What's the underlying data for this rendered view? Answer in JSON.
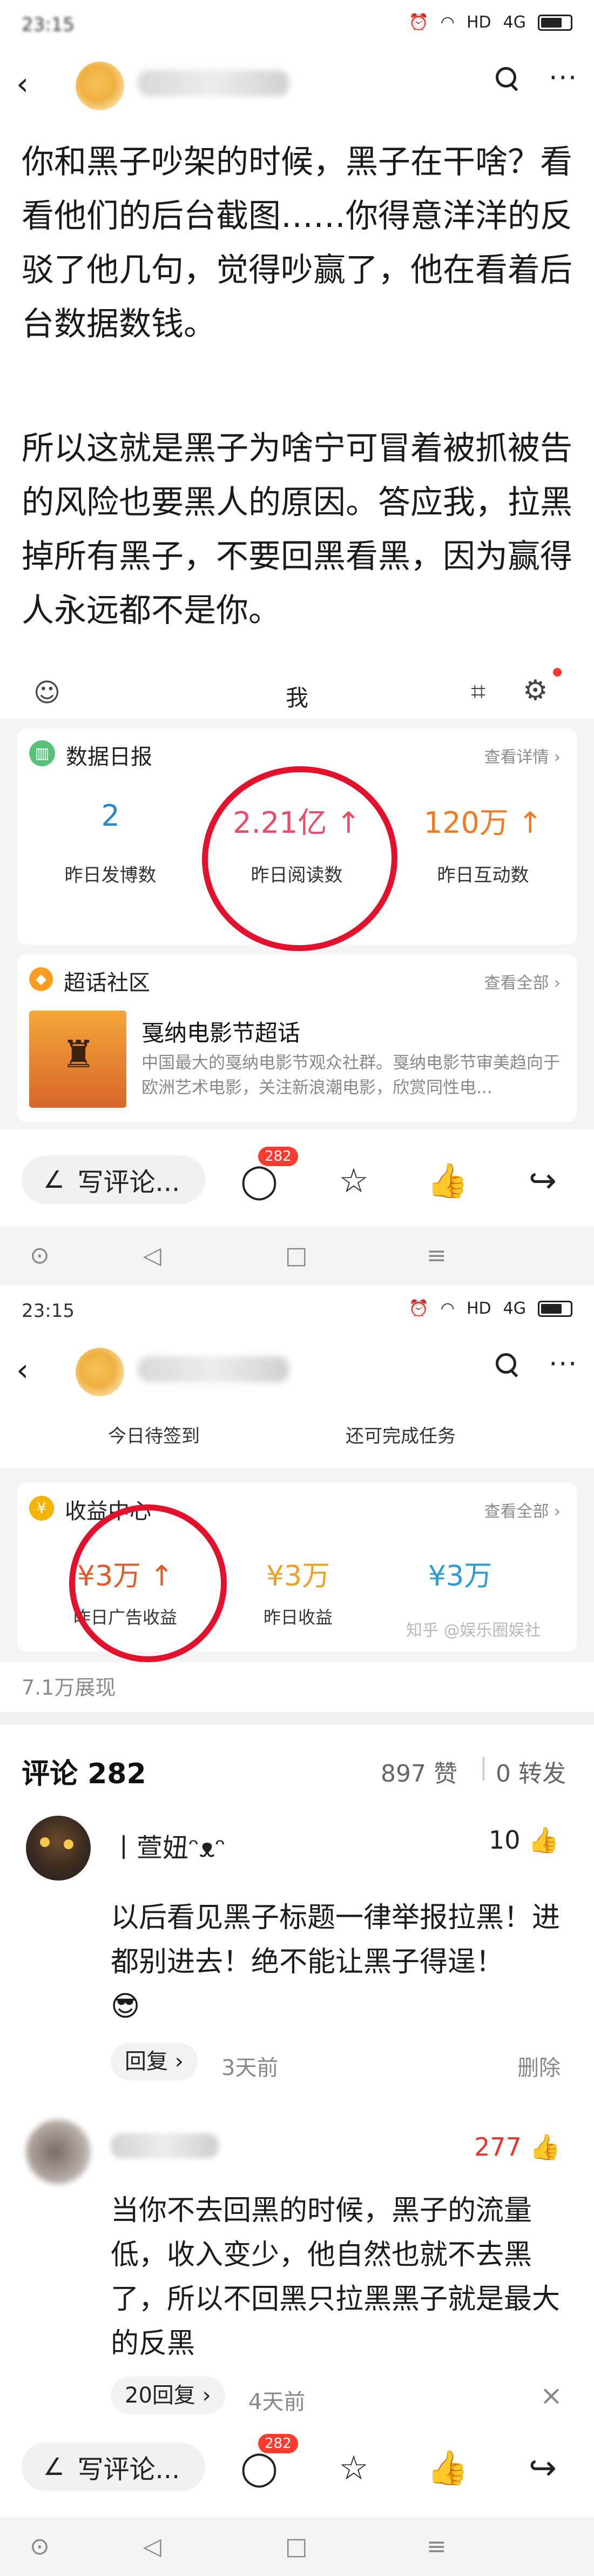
{
  "status": {
    "time_1": "23:15",
    "time_2": "23:15",
    "net": "HD",
    "signal": "4G"
  },
  "post": {
    "paragraph_1": "你和黑子吵架的时候，黑子在干啥？看看他们的后台截图……你得意洋洋的反驳了他几句，觉得吵赢了，他在看着后台数据数钱。",
    "paragraph_2": "所以这就是黑子为啥宁可冒着被抓被告的风险也要黑人的原因。答应我，拉黑掉所有黑子，不要回黑看黑，因为赢得人永远都不是你。",
    "views": "7.1万展现"
  },
  "embed1": {
    "header_title": "我",
    "daily_title": "数据日报",
    "daily_link": "查看详情 ›",
    "stats": [
      {
        "value": "2",
        "label": "昨日发博数",
        "arrow": ""
      },
      {
        "value": "2.21亿",
        "label": "昨日阅读数",
        "arrow": "↑"
      },
      {
        "value": "120万",
        "label": "昨日互动数",
        "arrow": "↑"
      }
    ],
    "super_title": "超话社区",
    "super_link": "查看全部 ›",
    "super_item_title": "戛纳电影节超话",
    "super_item_desc": "中国最大的戛纳电影节观众社群。戛纳电影节审美趋向于欧洲艺术电影，关注新浪潮电影，欣赏同性电..."
  },
  "embed2": {
    "btn_checkin": "今日待签到",
    "btn_tasks": "还可完成任务",
    "income_title": "收益中心",
    "income_link": "查看全部 ›",
    "income": [
      {
        "value": "¥3万",
        "label": "昨日广告收益",
        "arrow": "↑",
        "color": "#e05a2a"
      },
      {
        "value": "¥3万",
        "label": "昨日收益",
        "arrow": "",
        "color": "#f0a020"
      },
      {
        "value": "¥3万",
        "label": "",
        "arrow": "",
        "color": "#2a9ad8"
      }
    ],
    "watermark": "知乎 @娱乐圈娱社"
  },
  "footer": {
    "comment_placeholder": "写评论...",
    "comment_count_badge": "282"
  },
  "comments_header": {
    "title": "评论 282",
    "likes": "897 赞",
    "reposts": "0 转发",
    "separator": "|"
  },
  "comments": [
    {
      "username": "丨萱妞ᵔᴥᵔ",
      "likes": "10",
      "text": "以后看见黑子标题一律举报拉黑！进都别进去！绝不能让黑子得逞！",
      "emoji": "😎",
      "reply_label": "回复 ›",
      "time": "3天前",
      "delete_label": "删除"
    },
    {
      "username": "",
      "likes": "277",
      "text": "当你不去回黑的时候，黑子的流量低，收入变少，他自然也就不去黑了，所以不回黑只拉黑黑子就是最大的反黑",
      "reply_label": "20回复 ›",
      "time": "4天前",
      "close_label": "×"
    }
  ],
  "colors": {
    "red": "#e3112b",
    "orange": "#f07a22",
    "like_red": "#e8352b"
  }
}
